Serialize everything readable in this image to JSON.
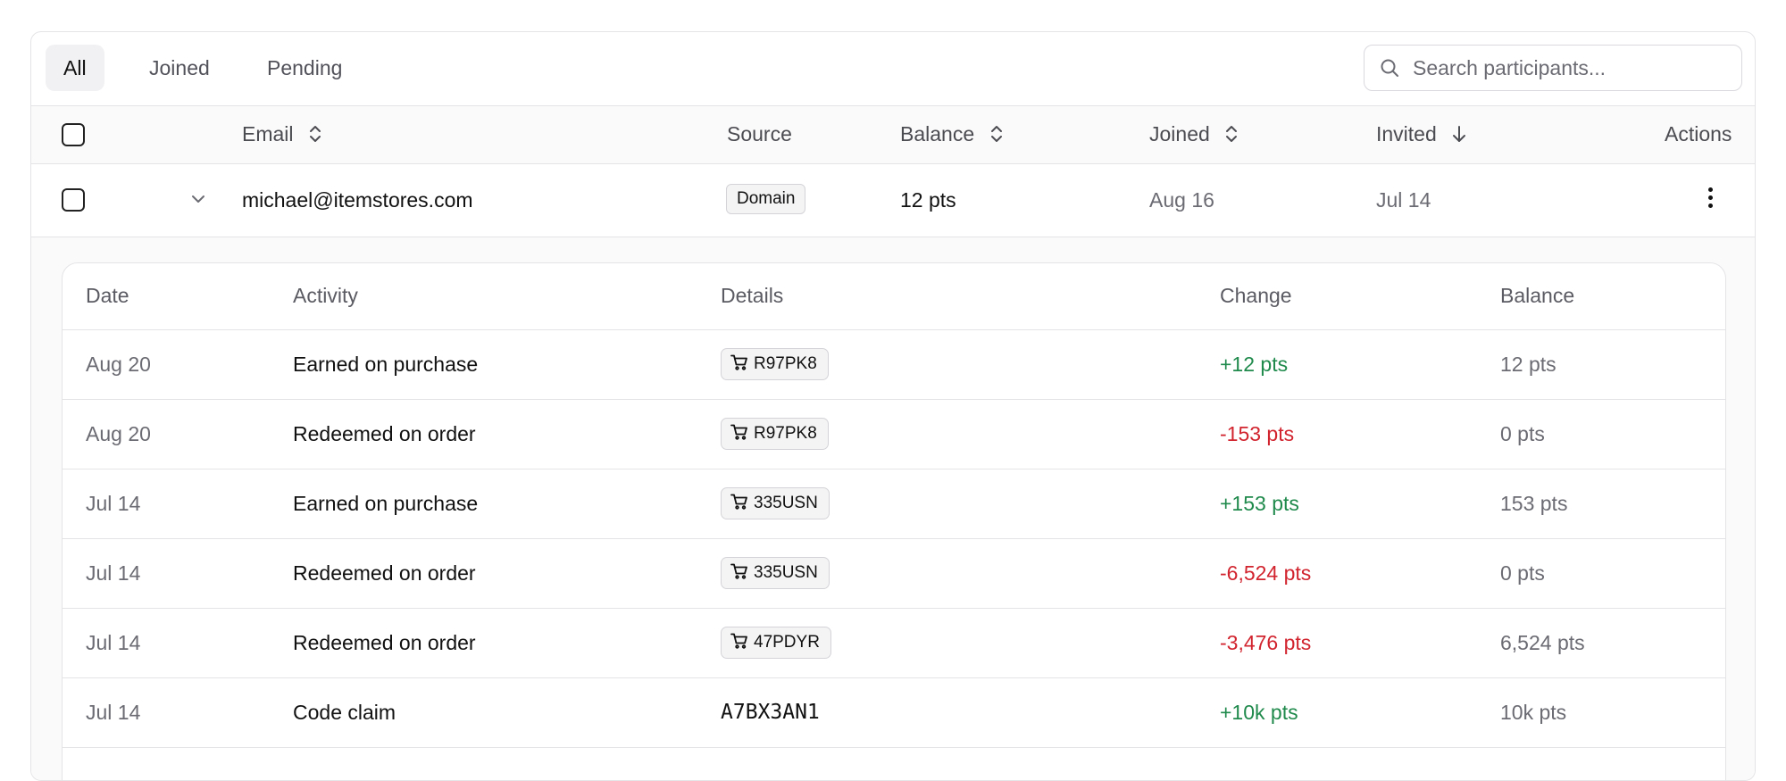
{
  "tabs": [
    {
      "label": "All",
      "active": true
    },
    {
      "label": "Joined",
      "active": false
    },
    {
      "label": "Pending",
      "active": false
    }
  ],
  "search": {
    "placeholder": "Search participants..."
  },
  "columns": {
    "email": "Email",
    "source": "Source",
    "balance": "Balance",
    "joined": "Joined",
    "invited": "Invited",
    "actions": "Actions"
  },
  "participant": {
    "email": "michael@itemstores.com",
    "source": "Domain",
    "balance": "12 pts",
    "joined": "Aug 16",
    "invited": "Jul 14"
  },
  "activity_columns": {
    "date": "Date",
    "activity": "Activity",
    "details": "Details",
    "change": "Change",
    "balance": "Balance"
  },
  "activity": [
    {
      "date": "Aug 20",
      "activity": "Earned on purchase",
      "details": "R97PK8",
      "details_type": "order",
      "change": "+12 pts",
      "change_sign": "positive",
      "balance": "12 pts"
    },
    {
      "date": "Aug 20",
      "activity": "Redeemed on order",
      "details": "R97PK8",
      "details_type": "order",
      "change": "-153 pts",
      "change_sign": "negative",
      "balance": "0 pts"
    },
    {
      "date": "Jul 14",
      "activity": "Earned on purchase",
      "details": "335USN",
      "details_type": "order",
      "change": "+153 pts",
      "change_sign": "positive",
      "balance": "153 pts"
    },
    {
      "date": "Jul 14",
      "activity": "Redeemed on order",
      "details": "335USN",
      "details_type": "order",
      "change": "-6,524 pts",
      "change_sign": "negative",
      "balance": "0 pts"
    },
    {
      "date": "Jul 14",
      "activity": "Redeemed on order",
      "details": "47PDYR",
      "details_type": "order",
      "change": "-3,476 pts",
      "change_sign": "negative",
      "balance": "6,524 pts"
    },
    {
      "date": "Jul 14",
      "activity": "Code claim",
      "details": "A7BX3AN1",
      "details_type": "code",
      "change": "+10k pts",
      "change_sign": "positive",
      "balance": "10k pts"
    }
  ],
  "icons": {
    "search": "search-icon",
    "sort": "sort-icon",
    "sort_desc": "arrow-down-icon",
    "expand": "chevron-down-icon",
    "row_menu": "more-vertical-icon",
    "order": "cart-icon"
  },
  "colors": {
    "positive": "#1f8a4c",
    "negative": "#d1242f",
    "border": "#e4e4e7",
    "active_tab_bg": "#f1f1f3"
  }
}
